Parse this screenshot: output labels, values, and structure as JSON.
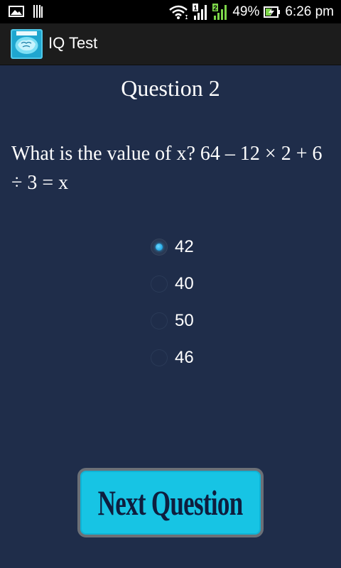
{
  "status_bar": {
    "battery_percent": "49%",
    "time": "6:26 pm",
    "icons": [
      "picture-icon",
      "sd-card-icon",
      "wifi-icon",
      "sim1-signal-icon",
      "sim2-signal-icon",
      "battery-charging-icon"
    ],
    "sim1_label": "1",
    "sim2_label": "2"
  },
  "action_bar": {
    "app_title": "IQ Test",
    "logo_icon": "iq-test-brain-icon"
  },
  "question": {
    "heading": "Question 2",
    "text": "What is the value of x?   64 – 12 × 2 + 6 ÷ 3 = x"
  },
  "options": [
    {
      "label": "42",
      "checked": true
    },
    {
      "label": "40",
      "checked": false
    },
    {
      "label": "50",
      "checked": false
    },
    {
      "label": "46",
      "checked": false
    }
  ],
  "next_button": {
    "label": "Next Question"
  },
  "colors": {
    "background": "#1f2d4a",
    "button": "#17c4e4",
    "button_text": "#0e1e3e",
    "radio_selected": "#1ea5e3"
  }
}
